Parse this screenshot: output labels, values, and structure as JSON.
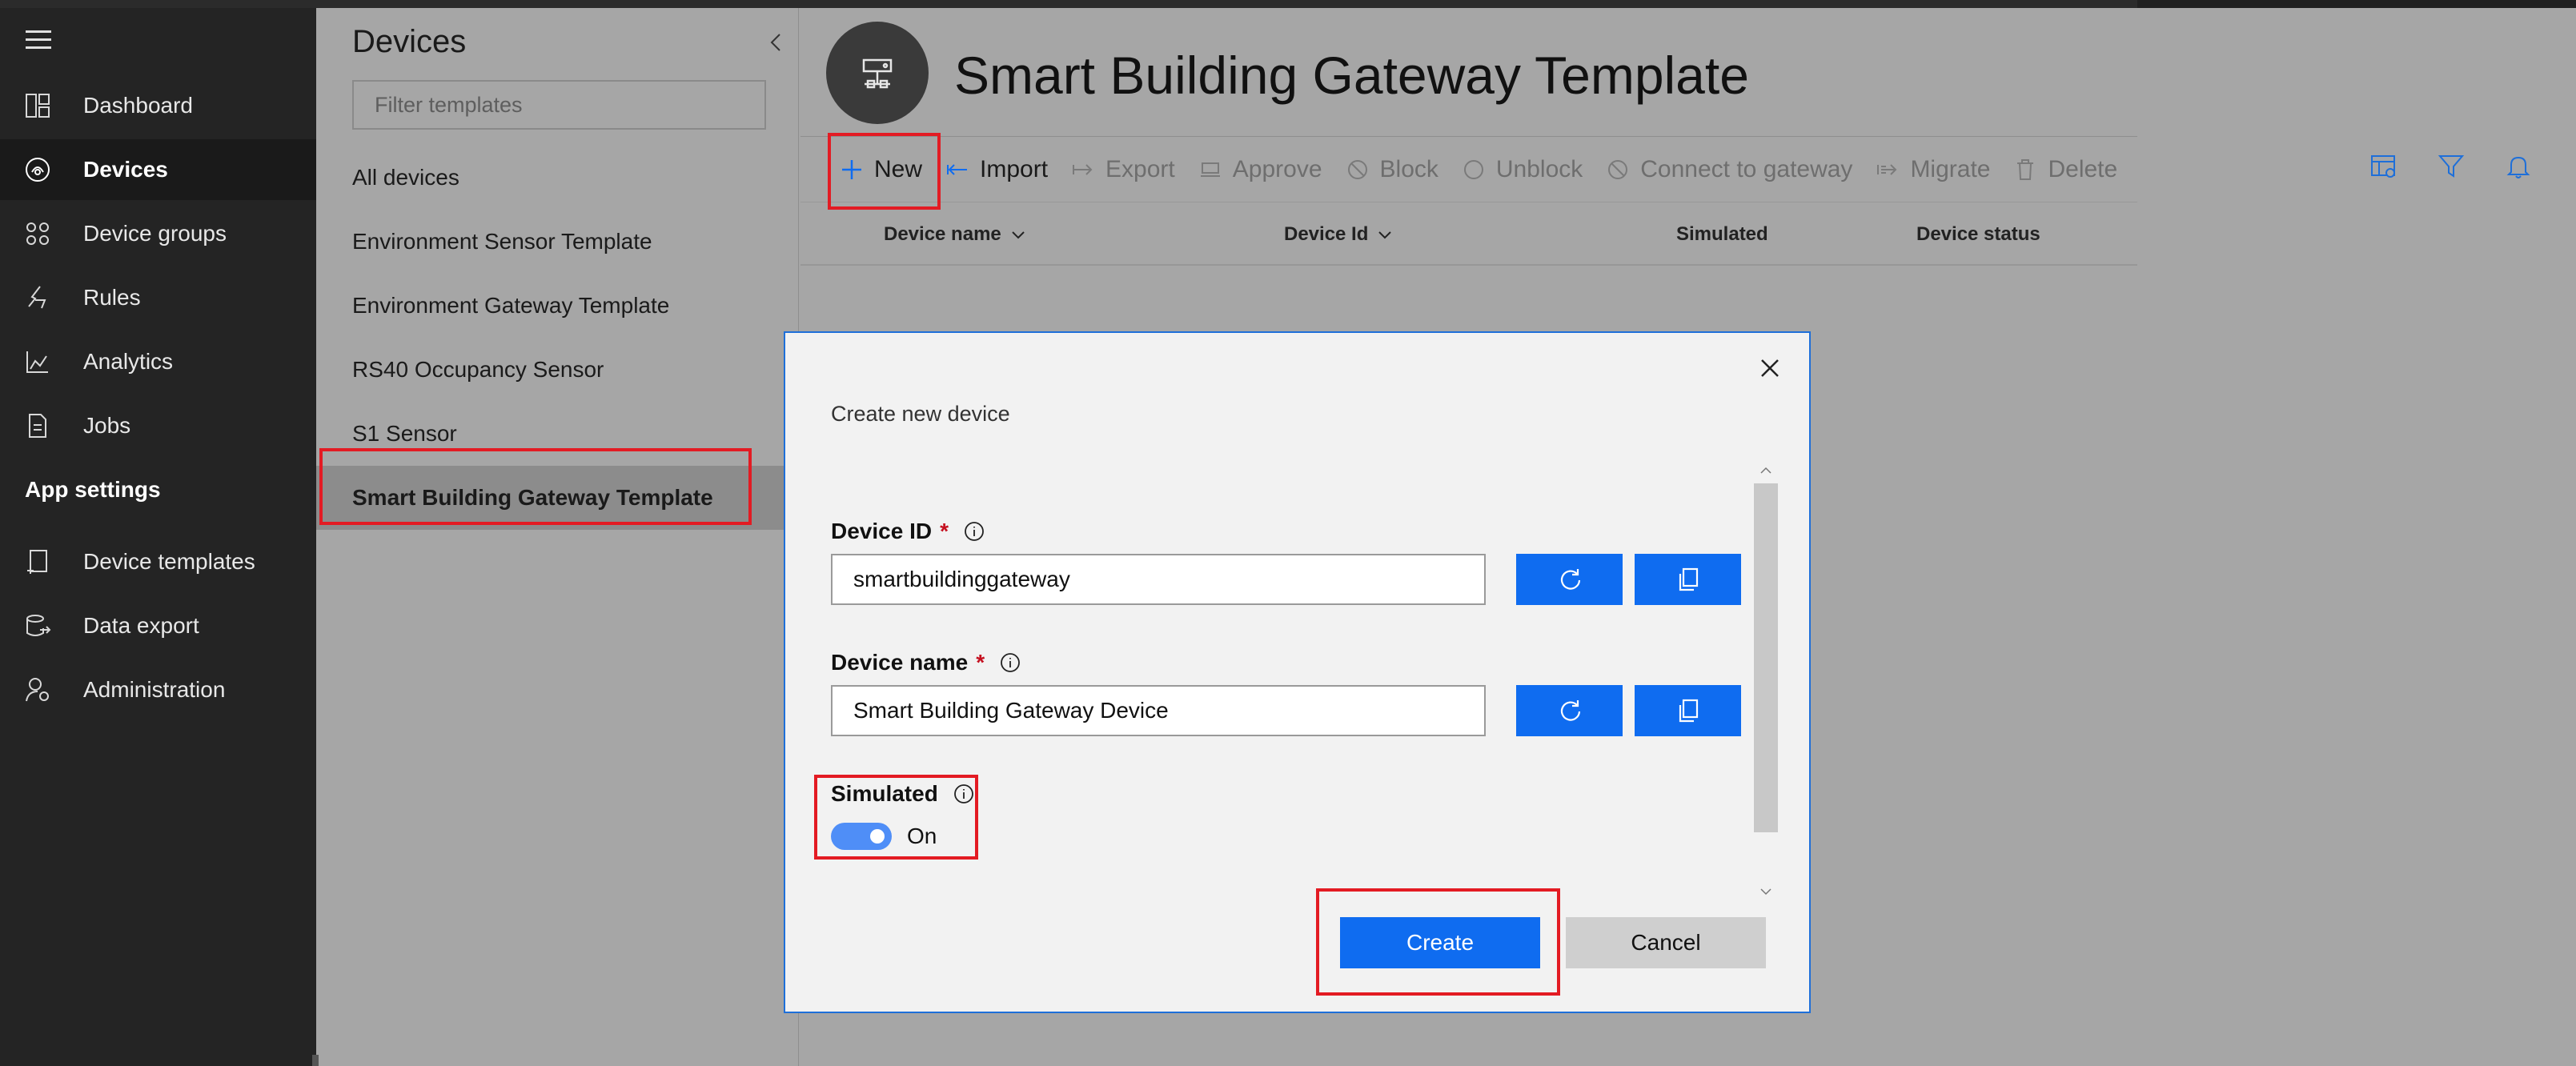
{
  "left_nav": {
    "items": [
      {
        "label": "Dashboard",
        "icon": "dashboard-icon"
      },
      {
        "label": "Devices",
        "icon": "devices-icon",
        "active": true
      },
      {
        "label": "Device groups",
        "icon": "device-groups-icon"
      },
      {
        "label": "Rules",
        "icon": "rules-icon"
      },
      {
        "label": "Analytics",
        "icon": "analytics-icon"
      },
      {
        "label": "Jobs",
        "icon": "jobs-icon"
      }
    ],
    "section_heading": "App settings",
    "settings_items": [
      {
        "label": "Device templates",
        "icon": "device-templates-icon"
      },
      {
        "label": "Data export",
        "icon": "data-export-icon"
      },
      {
        "label": "Administration",
        "icon": "administration-icon"
      }
    ]
  },
  "templates_panel": {
    "title": "Devices",
    "filter_placeholder": "Filter templates",
    "items": [
      "All devices",
      "Environment Sensor Template",
      "Environment Gateway Template",
      "RS40 Occupancy Sensor",
      "S1 Sensor",
      "Smart Building Gateway Template"
    ],
    "selected": "Smart Building Gateway Template"
  },
  "header": {
    "title": "Smart Building Gateway Template"
  },
  "toolbar": {
    "new": "New",
    "import": "Import",
    "export": "Export",
    "approve": "Approve",
    "block": "Block",
    "unblock": "Unblock",
    "connect_to_gateway": "Connect to gateway",
    "migrate": "Migrate",
    "delete": "Delete"
  },
  "table": {
    "columns": [
      "Device name",
      "Device Id",
      "Simulated",
      "Device status"
    ]
  },
  "dialog": {
    "title": "Create new device",
    "device_id_label": "Device ID",
    "device_id_value": "smartbuildinggateway",
    "device_name_label": "Device name",
    "device_name_value": "Smart Building Gateway Device",
    "required_marker": "*",
    "simulated_label": "Simulated",
    "simulated_state": "On",
    "create_label": "Create",
    "cancel_label": "Cancel"
  },
  "colors": {
    "accent": "#0f6cf0",
    "highlight": "#e31b23",
    "nav_bg": "#242424",
    "overlay": "#a6a6a6"
  }
}
